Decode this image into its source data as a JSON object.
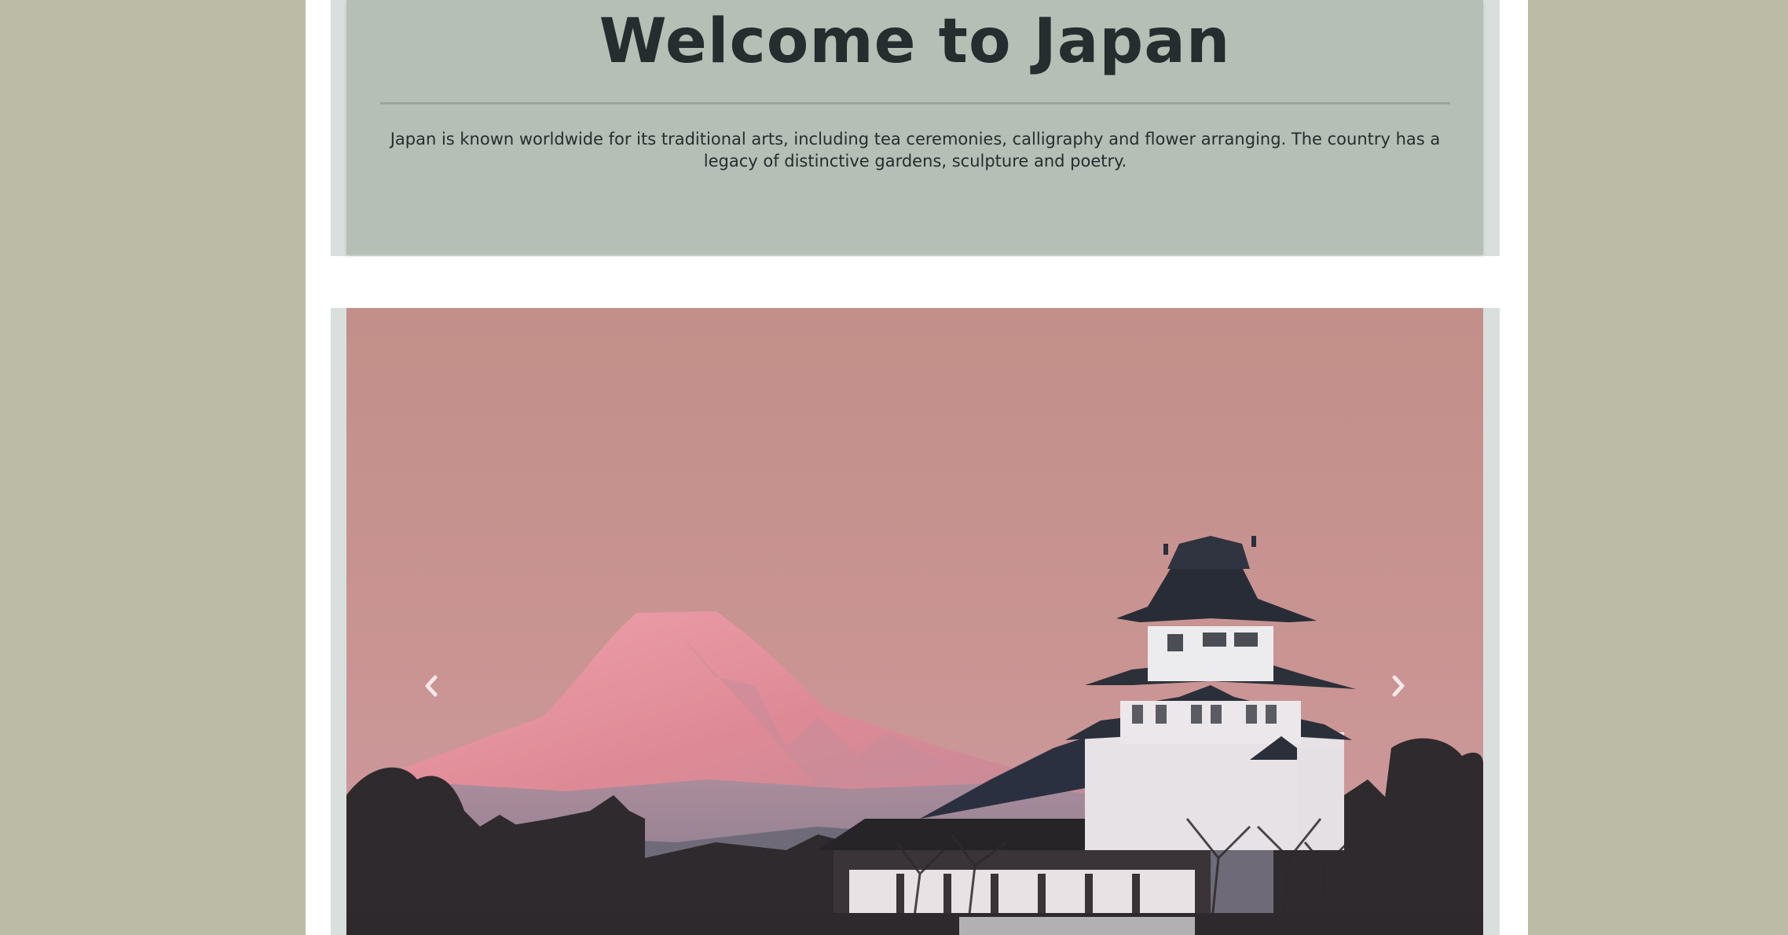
{
  "welcome": {
    "title": "Welcome to Japan",
    "description": "Japan is known worldwide for its traditional arts, including tea ceremonies, calligraphy and flower arranging. The country has a legacy of distinctive gardens, sculpture and poetry."
  },
  "carousel": {
    "prev_icon": "chevron-left-icon",
    "next_icon": "chevron-right-icon",
    "slide": {
      "subject": "mount-fuji-and-castle-at-dusk",
      "sky_color": "#c4918a",
      "mountain_color": "#e08a95"
    }
  },
  "colors": {
    "background": "#bcbca6",
    "page": "#ffffff",
    "panel": "#b5bfb6",
    "panel_border": "#d9dfdc",
    "text": "#262d2e"
  }
}
